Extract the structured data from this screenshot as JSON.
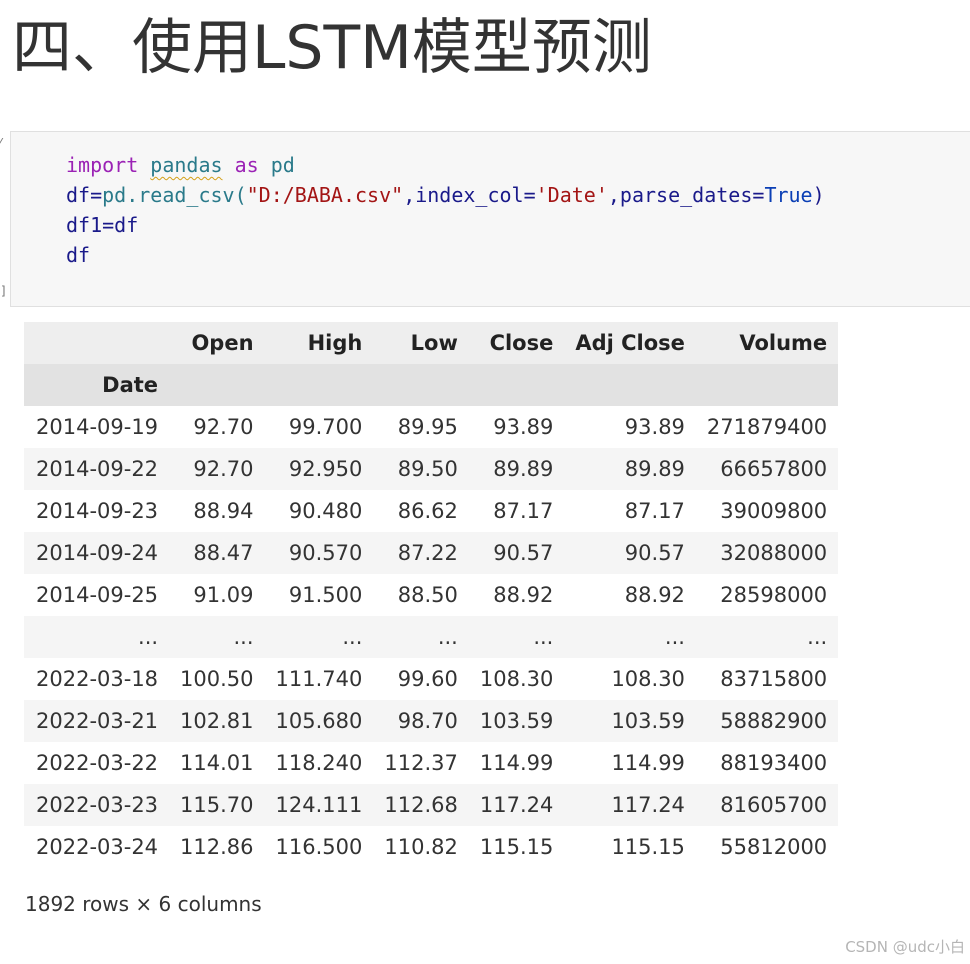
{
  "heading": "四、使用LSTM模型预测",
  "code_cell": {
    "prompt_bottom": "]",
    "lines": [
      {
        "tokens": [
          {
            "t": "import",
            "c": "kw"
          },
          {
            "t": " ",
            "c": "op"
          },
          {
            "t": "pandas",
            "c": "mod"
          },
          {
            "t": " ",
            "c": "op"
          },
          {
            "t": "as",
            "c": "kw"
          },
          {
            "t": " pd",
            "c": "fn"
          }
        ]
      },
      {
        "tokens": [
          {
            "t": "df=",
            "c": "op"
          },
          {
            "t": "pd",
            "c": "fn"
          },
          {
            "t": ".read_csv(",
            "c": "fn"
          },
          {
            "t": "\"D:/BABA.csv\"",
            "c": "str"
          },
          {
            "t": ",index_col=",
            "c": "op"
          },
          {
            "t": "'Date'",
            "c": "str"
          },
          {
            "t": ",parse_dates=",
            "c": "op"
          },
          {
            "t": "True",
            "c": "lit"
          },
          {
            "t": ")",
            "c": "op"
          }
        ]
      },
      {
        "tokens": [
          {
            "t": "df1=df",
            "c": "op"
          }
        ]
      },
      {
        "tokens": [
          {
            "t": "df",
            "c": "op"
          }
        ]
      }
    ]
  },
  "table": {
    "columns": [
      "",
      "Open",
      "High",
      "Low",
      "Close",
      "Adj Close",
      "Volume"
    ],
    "index_name": "Date",
    "rows": [
      [
        "2014-09-19",
        "92.70",
        "99.700",
        "89.95",
        "93.89",
        "93.89",
        "271879400"
      ],
      [
        "2014-09-22",
        "92.70",
        "92.950",
        "89.50",
        "89.89",
        "89.89",
        "66657800"
      ],
      [
        "2014-09-23",
        "88.94",
        "90.480",
        "86.62",
        "87.17",
        "87.17",
        "39009800"
      ],
      [
        "2014-09-24",
        "88.47",
        "90.570",
        "87.22",
        "90.57",
        "90.57",
        "32088000"
      ],
      [
        "2014-09-25",
        "91.09",
        "91.500",
        "88.50",
        "88.92",
        "88.92",
        "28598000"
      ],
      [
        "...",
        "...",
        "...",
        "...",
        "...",
        "...",
        "..."
      ],
      [
        "2022-03-18",
        "100.50",
        "111.740",
        "99.60",
        "108.30",
        "108.30",
        "83715800"
      ],
      [
        "2022-03-21",
        "102.81",
        "105.680",
        "98.70",
        "103.59",
        "103.59",
        "58882900"
      ],
      [
        "2022-03-22",
        "114.01",
        "118.240",
        "112.37",
        "114.99",
        "114.99",
        "88193400"
      ],
      [
        "2022-03-23",
        "115.70",
        "124.111",
        "112.68",
        "117.24",
        "117.24",
        "81605700"
      ],
      [
        "2022-03-24",
        "112.86",
        "116.500",
        "110.82",
        "115.15",
        "115.15",
        "55812000"
      ]
    ]
  },
  "shape_text": "1892 rows × 6 columns",
  "watermark": "CSDN @udc小白"
}
